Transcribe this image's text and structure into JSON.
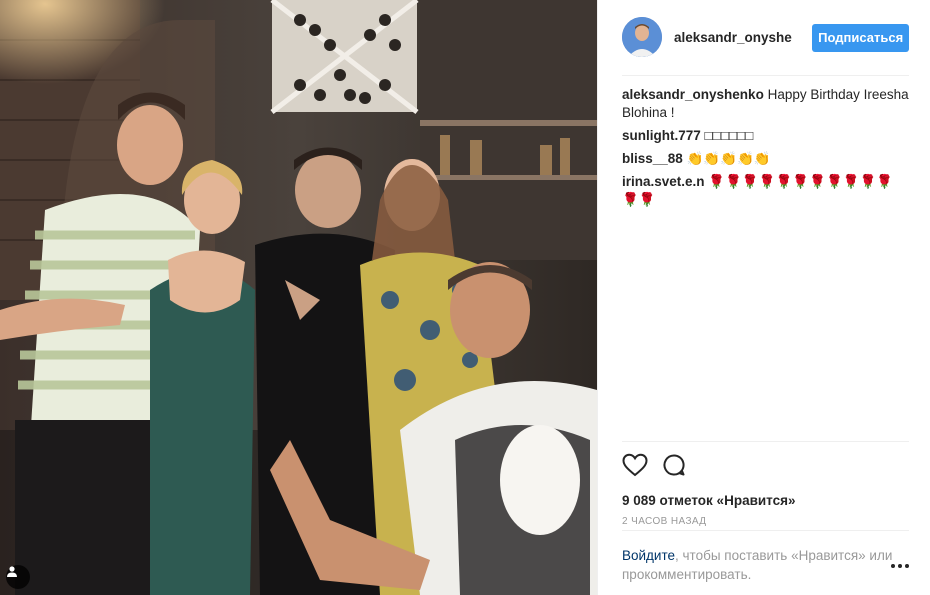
{
  "post": {
    "username": "aleksandr_onyshe",
    "follow_label": "Подписаться",
    "caption": {
      "author": "aleksandr_onyshenko",
      "text": "Happy Birthday Ireesha Blohina !"
    },
    "comments": [
      {
        "author": "sunlight.777",
        "text": "□□□□□□"
      },
      {
        "author": "bliss__88",
        "text": "👏👏👏👏👏"
      },
      {
        "author": "irina.svet.e.n",
        "text": "🌹🌹🌹🌹🌹🌹🌹🌹🌹🌹🌹🌹🌹"
      }
    ],
    "likes_text": "9 089 отметок «Нравится»",
    "time_ago": "2 часов назад",
    "login_link": "Войдите",
    "login_rest": ", чтобы поставить «Нравится» или прокомментировать."
  },
  "icons": {
    "heart": "heart-icon",
    "comment": "comment-icon",
    "more": "more-options-icon",
    "tag": "tagged-user-icon"
  },
  "colors": {
    "accent": "#3897f0",
    "link": "#003569",
    "muted": "#999999"
  }
}
